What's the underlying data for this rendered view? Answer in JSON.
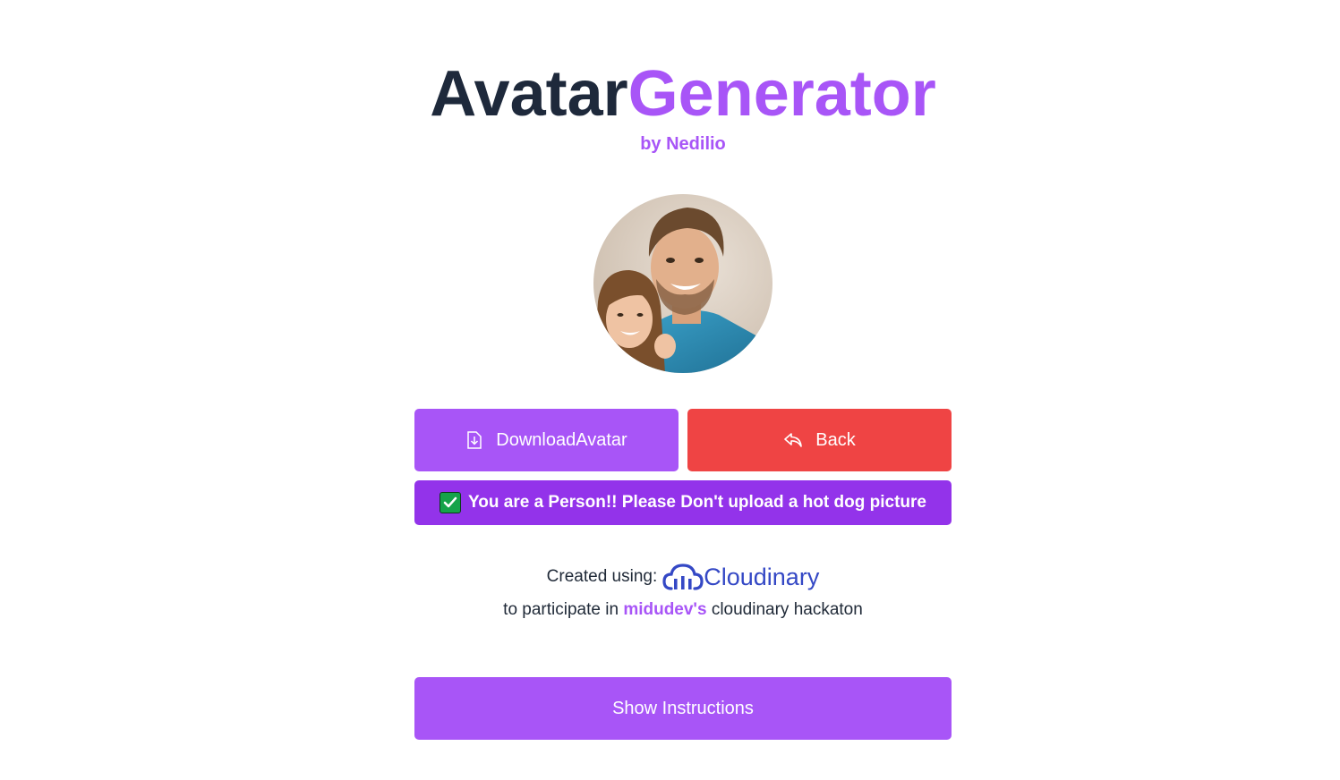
{
  "header": {
    "title_part1": "Avatar",
    "title_part2": "Generator",
    "byline": "by Nedilio"
  },
  "avatar": {
    "alt": "avatar photo"
  },
  "actions": {
    "download_label": "DownloadAvatar",
    "back_label": "Back"
  },
  "notice": {
    "icon": "check-mark-icon",
    "text": "You are a Person!! Please Don't upload a hot dog picture"
  },
  "credits": {
    "created_using": "Created using:",
    "brand": "Cloudinary",
    "participate_prefix": "to participate in",
    "link_text": "midudev's",
    "participate_suffix": "cloudinary hackaton"
  },
  "instructions": {
    "button_label": "Show Instructions"
  },
  "colors": {
    "accent": "#a855f7",
    "danger": "#ef4444",
    "notice_bg": "#9333ea",
    "cloudinary": "#3448c5"
  }
}
